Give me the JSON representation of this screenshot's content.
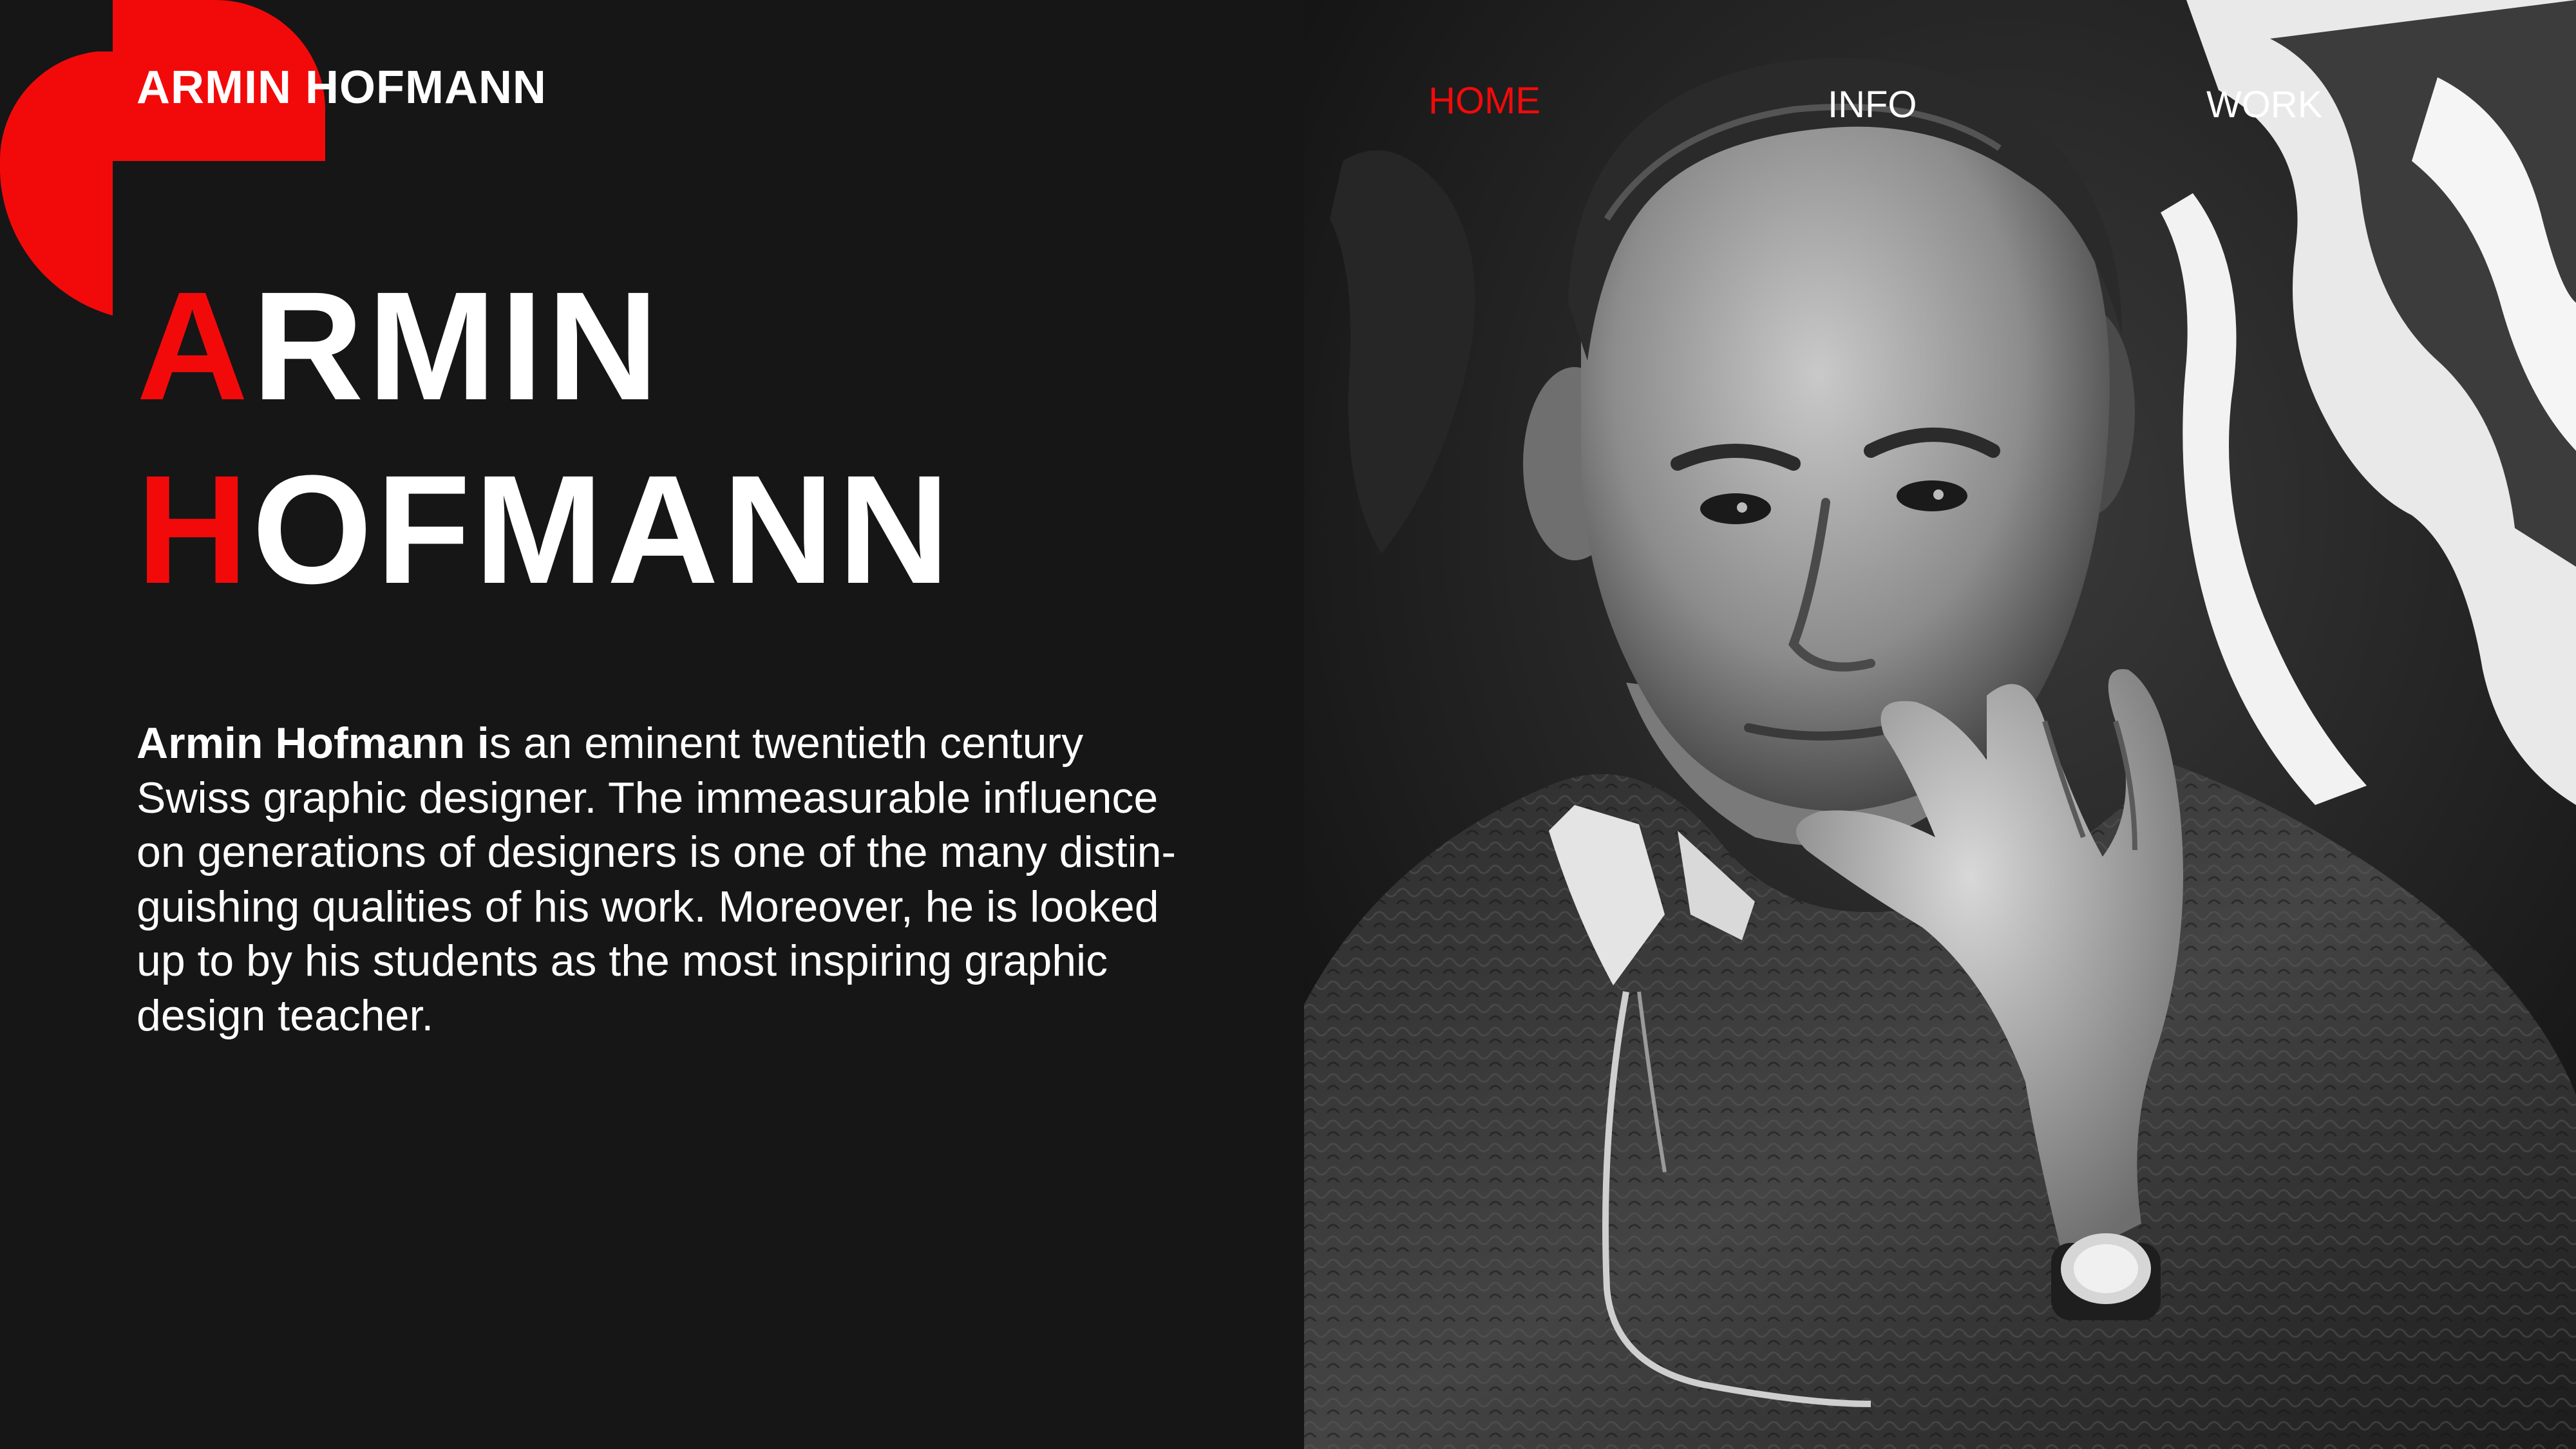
{
  "brand": {
    "first": "ARMIN",
    "last": "HOFMANN"
  },
  "nav": {
    "home": "HOME",
    "info": "INFO",
    "work": "WORK",
    "active": "home"
  },
  "hero": {
    "line1_initial": "A",
    "line1_rest": "RMIN",
    "line2_initial": "H",
    "line2_rest": "OFMANN"
  },
  "intro": {
    "lead": "Armin Hofmann i",
    "line1_rest": "s an eminent twentieth century",
    "line2": "Swiss graphic designer. The immeasurable influence",
    "line3": "on generations of designers is one of the many distin-",
    "line4": "guishing qualities of his work. Moreover, he is looked",
    "line5": "up to by his students as the most inspiring graphic",
    "line6": "design teacher."
  },
  "colors": {
    "background": "#161617",
    "accent": "#f20a0a",
    "text": "#ffffff"
  },
  "icons": {
    "logo": "red-quarter-circle-mark"
  }
}
